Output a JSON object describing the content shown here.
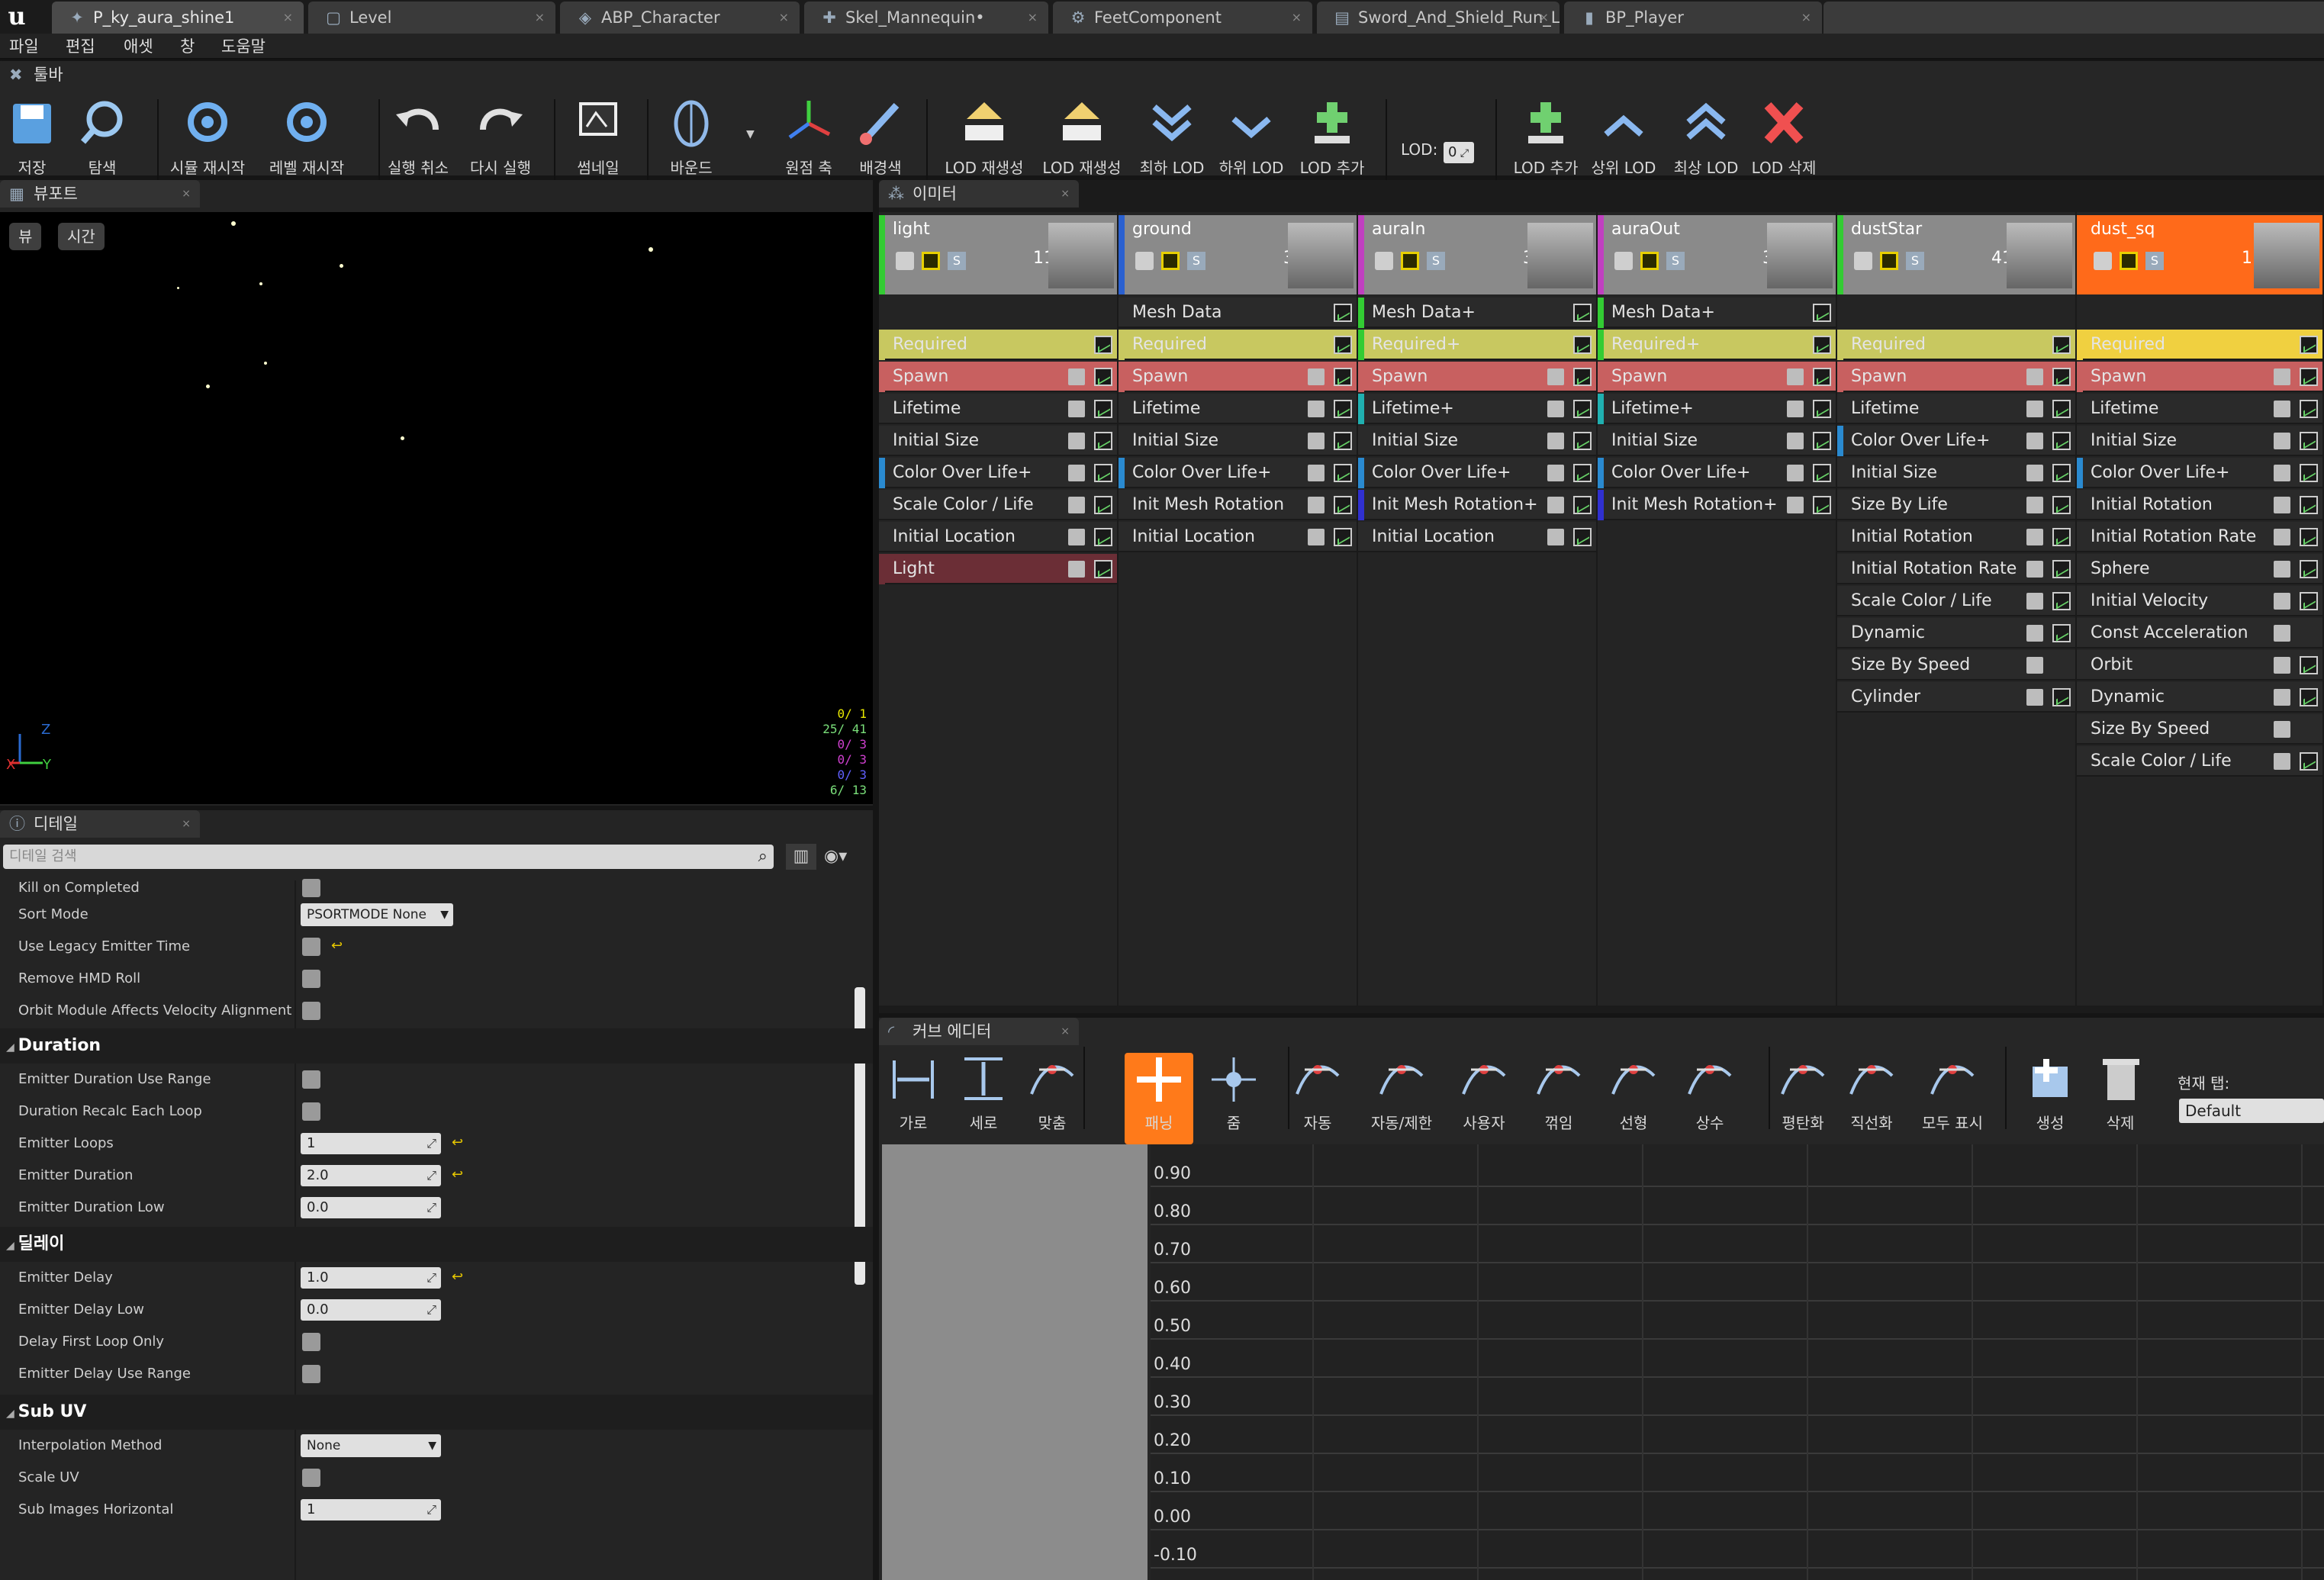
{
  "tabs": [
    {
      "label": "P_ky_aura_shine1",
      "icon": "particle-system-icon",
      "active": true
    },
    {
      "label": "Level",
      "icon": "level-icon",
      "active": false
    },
    {
      "label": "ABP_Character",
      "icon": "anim-blueprint-icon",
      "active": false
    },
    {
      "label": "Skel_Mannequin•",
      "icon": "skeleton-icon",
      "active": false
    },
    {
      "label": "FeetComponent",
      "icon": "component-icon",
      "active": false
    },
    {
      "label": "Sword_And_Shield_Run_L",
      "icon": "anim-sequence-icon",
      "active": false
    },
    {
      "label": "BP_Player",
      "icon": "blueprint-icon",
      "active": false
    }
  ],
  "menu": [
    "파일",
    "편집",
    "애셋",
    "창",
    "도움말"
  ],
  "toolbar_panel": {
    "title": "툴바"
  },
  "toolbar": [
    {
      "label": "저장",
      "icon": "save-icon"
    },
    {
      "label": "탐색",
      "icon": "browse-icon"
    },
    {
      "label": "시뮬 재시작",
      "icon": "restart-sim-icon"
    },
    {
      "label": "레벨 재시작",
      "icon": "restart-level-icon"
    },
    {
      "label": "실행 취소",
      "icon": "undo-icon"
    },
    {
      "label": "다시 실행",
      "icon": "redo-icon"
    },
    {
      "label": "썸네일",
      "icon": "thumbnail-icon"
    },
    {
      "label": "바운드",
      "icon": "bounds-icon"
    },
    {
      "label": "원점 축",
      "icon": "origin-axis-icon"
    },
    {
      "label": "배경색",
      "icon": "background-color-icon"
    },
    {
      "label": "LOD 재생성",
      "icon": "regen-lod-icon"
    },
    {
      "label": "LOD 재생성",
      "icon": "regen-lod-icon"
    },
    {
      "label": "최하 LOD",
      "icon": "lowest-lod-icon"
    },
    {
      "label": "하위 LOD",
      "icon": "lower-lod-icon"
    },
    {
      "label": "LOD 추가",
      "icon": "add-lod-icon"
    },
    {
      "label": "LOD 추가",
      "icon": "add-lod-icon"
    },
    {
      "label": "상위 LOD",
      "icon": "higher-lod-icon"
    },
    {
      "label": "최상 LOD",
      "icon": "highest-lod-icon"
    },
    {
      "label": "LOD 삭제",
      "icon": "delete-lod-icon"
    }
  ],
  "lod": {
    "label": "LOD:",
    "value": "0"
  },
  "viewport": {
    "title": "뷰포트",
    "view_btn": "뷰",
    "time_btn": "시간",
    "stats": [
      {
        "text": "0/  1",
        "color": "#e8e800"
      },
      {
        "text": "25/  41",
        "color": "#7adf7a"
      },
      {
        "text": "0/  3",
        "color": "#d040d0"
      },
      {
        "text": "0/  3",
        "color": "#d040d0"
      },
      {
        "text": "0/  3",
        "color": "#6060ff"
      },
      {
        "text": "6/  13",
        "color": "#7adf7a"
      }
    ],
    "axis": {
      "x": "X",
      "y": "Y",
      "z": "Z"
    }
  },
  "details": {
    "title": "디테일",
    "search_placeholder": "디테일 검색",
    "sections": [
      {
        "name": "",
        "rows": [
          {
            "label": "Kill on Completed",
            "type": "check"
          },
          {
            "label": "Sort Mode",
            "type": "dropdown",
            "value": "PSORTMODE None"
          },
          {
            "label": "Use Legacy Emitter Time",
            "type": "check",
            "reset": true
          },
          {
            "label": "Remove HMD Roll",
            "type": "check"
          },
          {
            "label": "Orbit Module Affects Velocity Alignment",
            "type": "check"
          }
        ]
      },
      {
        "name": "Duration",
        "rows": [
          {
            "label": "Emitter Duration Use Range",
            "type": "check"
          },
          {
            "label": "Duration Recalc Each Loop",
            "type": "check"
          },
          {
            "label": "Emitter Loops",
            "type": "number",
            "value": "1",
            "reset": true
          },
          {
            "label": "Emitter Duration",
            "type": "number",
            "value": "2.0",
            "reset": true
          },
          {
            "label": "Emitter Duration Low",
            "type": "number",
            "value": "0.0"
          }
        ]
      },
      {
        "name": "딜레이",
        "rows": [
          {
            "label": "Emitter Delay",
            "type": "number",
            "value": "1.0",
            "reset": true
          },
          {
            "label": "Emitter Delay Low",
            "type": "number",
            "value": "0.0"
          },
          {
            "label": "Delay First Loop Only",
            "type": "check"
          },
          {
            "label": "Emitter Delay Use Range",
            "type": "check"
          }
        ]
      },
      {
        "name": "Sub UV",
        "rows": [
          {
            "label": "Interpolation Method",
            "type": "dropdown",
            "value": "None"
          },
          {
            "label": "Scale UV",
            "type": "check"
          },
          {
            "label": "Sub Images Horizontal",
            "type": "number",
            "value": "1"
          }
        ]
      }
    ]
  },
  "emitters_panel": {
    "title": "이미터"
  },
  "emitters": [
    {
      "name": "light",
      "count": "11",
      "bar": "#33cc33",
      "head": "#8a8a8a",
      "modules": [
        {
          "label": "Required",
          "color": "#c8c860",
          "bar": "#c8c860",
          "checks": "g"
        },
        {
          "label": "Spawn",
          "color": "#c86060",
          "bar": "#c86060",
          "checks": "cg"
        },
        {
          "label": "Lifetime",
          "color": "",
          "bar": "",
          "checks": "cg"
        },
        {
          "label": "Initial Size",
          "color": "",
          "bar": "",
          "checks": "cg"
        },
        {
          "label": "Color Over Life+",
          "color": "",
          "bar": "#2a8ad0",
          "checks": "cg"
        },
        {
          "label": "Scale Color / Life",
          "color": "",
          "bar": "",
          "checks": "cg"
        },
        {
          "label": "Initial Location",
          "color": "",
          "bar": "",
          "checks": "cg"
        },
        {
          "label": "Light",
          "color": "#6b2e36",
          "bar": "#6b2e36",
          "checks": "cg"
        }
      ]
    },
    {
      "name": "ground",
      "count": "3",
      "bar": "#2a60d0",
      "head": "#8a8a8a",
      "modules": [
        {
          "label": "Mesh Data",
          "color": "",
          "bar": "",
          "checks": "g"
        },
        {
          "label": "Required",
          "color": "#c8c860",
          "bar": "#c8c860",
          "checks": "g"
        },
        {
          "label": "Spawn",
          "color": "#c86060",
          "bar": "#c86060",
          "checks": "cg"
        },
        {
          "label": "Lifetime",
          "color": "",
          "bar": "",
          "checks": "cg"
        },
        {
          "label": "Initial Size",
          "color": "",
          "bar": "",
          "checks": "cg"
        },
        {
          "label": "Color Over Life+",
          "color": "",
          "bar": "#2a8ad0",
          "checks": "cg"
        },
        {
          "label": "Init Mesh Rotation",
          "color": "",
          "bar": "",
          "checks": "cg"
        },
        {
          "label": "Initial Location",
          "color": "",
          "bar": "",
          "checks": "cg"
        }
      ]
    },
    {
      "name": "auraIn",
      "count": "3",
      "bar": "#c040c0",
      "head": "#8a8a8a",
      "modules": [
        {
          "label": "Mesh Data+",
          "color": "",
          "bar": "#33cc33",
          "checks": "g"
        },
        {
          "label": "Required+",
          "color": "#c8c860",
          "bar": "#33cc33",
          "checks": "g"
        },
        {
          "label": "Spawn",
          "color": "#c86060",
          "bar": "#c86060",
          "checks": "cg"
        },
        {
          "label": "Lifetime+",
          "color": "",
          "bar": "#20b0b0",
          "checks": "cg"
        },
        {
          "label": "Initial Size",
          "color": "",
          "bar": "",
          "checks": "cg"
        },
        {
          "label": "Color Over Life+",
          "color": "",
          "bar": "#2a8ad0",
          "checks": "cg"
        },
        {
          "label": "Init Mesh Rotation+",
          "color": "",
          "bar": "#3030d0",
          "checks": "cg"
        },
        {
          "label": "Initial Location",
          "color": "",
          "bar": "",
          "checks": "cg"
        }
      ]
    },
    {
      "name": "auraOut",
      "count": "3",
      "bar": "#c040c0",
      "head": "#8a8a8a",
      "modules": [
        {
          "label": "Mesh Data+",
          "color": "",
          "bar": "#33cc33",
          "checks": "g"
        },
        {
          "label": "Required+",
          "color": "#c8c860",
          "bar": "#33cc33",
          "checks": "g"
        },
        {
          "label": "Spawn",
          "color": "#c86060",
          "bar": "#c86060",
          "checks": "cg"
        },
        {
          "label": "Lifetime+",
          "color": "",
          "bar": "#20b0b0",
          "checks": "cg"
        },
        {
          "label": "Initial Size",
          "color": "",
          "bar": "",
          "checks": "cg"
        },
        {
          "label": "Color Over Life+",
          "color": "",
          "bar": "#2a8ad0",
          "checks": "cg"
        },
        {
          "label": "Init Mesh Rotation+",
          "color": "",
          "bar": "#3030d0",
          "checks": "cg"
        }
      ]
    },
    {
      "name": "dustStar",
      "count": "41",
      "bar": "#33cc33",
      "head": "#8a8a8a",
      "modules": [
        {
          "label": "Required",
          "color": "#c8c860",
          "bar": "#c8c860",
          "checks": "g"
        },
        {
          "label": "Spawn",
          "color": "#c86060",
          "bar": "#c86060",
          "checks": "cg"
        },
        {
          "label": "Lifetime",
          "color": "",
          "bar": "",
          "checks": "cg"
        },
        {
          "label": "Color Over Life+",
          "color": "",
          "bar": "#2a8ad0",
          "checks": "cg"
        },
        {
          "label": "Initial Size",
          "color": "",
          "bar": "",
          "checks": "cg"
        },
        {
          "label": "Size By Life",
          "color": "",
          "bar": "",
          "checks": "cg"
        },
        {
          "label": "Initial Rotation",
          "color": "",
          "bar": "",
          "checks": "cg"
        },
        {
          "label": "Initial Rotation Rate",
          "color": "",
          "bar": "",
          "checks": "cg"
        },
        {
          "label": "Scale Color / Life",
          "color": "",
          "bar": "",
          "checks": "cg"
        },
        {
          "label": "Dynamic",
          "color": "",
          "bar": "",
          "checks": "cg"
        },
        {
          "label": "Size By Speed",
          "color": "",
          "bar": "",
          "checks": "c"
        },
        {
          "label": "Cylinder",
          "color": "",
          "bar": "",
          "checks": "cg"
        }
      ]
    },
    {
      "name": "dust_sq",
      "count": "1",
      "bar": "#ff6a1a",
      "head": "#ff6a1a",
      "modules": [
        {
          "label": "Required",
          "color": "#f0d040",
          "bar": "#f0d040",
          "checks": "g"
        },
        {
          "label": "Spawn",
          "color": "#c86060",
          "bar": "#c86060",
          "checks": "cg"
        },
        {
          "label": "Lifetime",
          "color": "",
          "bar": "",
          "checks": "cg"
        },
        {
          "label": "Initial Size",
          "color": "",
          "bar": "",
          "checks": "cg"
        },
        {
          "label": "Color Over Life+",
          "color": "",
          "bar": "#2a8ad0",
          "checks": "cg"
        },
        {
          "label": "Initial Rotation",
          "color": "",
          "bar": "",
          "checks": "cg"
        },
        {
          "label": "Initial Rotation Rate",
          "color": "",
          "bar": "",
          "checks": "cg"
        },
        {
          "label": "Sphere",
          "color": "",
          "bar": "",
          "checks": "cg"
        },
        {
          "label": "Initial Velocity",
          "color": "",
          "bar": "",
          "checks": "cg"
        },
        {
          "label": "Const Acceleration",
          "color": "",
          "bar": "",
          "checks": "c"
        },
        {
          "label": "Orbit",
          "color": "",
          "bar": "",
          "checks": "cg"
        },
        {
          "label": "Dynamic",
          "color": "",
          "bar": "",
          "checks": "cg"
        },
        {
          "label": "Size By Speed",
          "color": "",
          "bar": "",
          "checks": "c"
        },
        {
          "label": "Scale Color / Life",
          "color": "",
          "bar": "",
          "checks": "cg"
        }
      ]
    }
  ],
  "curve_editor": {
    "title": "커브 에디터",
    "buttons": [
      {
        "label": "가로",
        "icon": "fit-horizontal-icon"
      },
      {
        "label": "세로",
        "icon": "fit-vertical-icon"
      },
      {
        "label": "맞춤",
        "icon": "fit-icon"
      },
      {
        "label": "패닝",
        "icon": "pan-icon",
        "active": true
      },
      {
        "label": "줌",
        "icon": "zoom-icon"
      },
      {
        "label": "자동",
        "icon": "auto-tangent-icon"
      },
      {
        "label": "자동/제한",
        "icon": "auto-clamped-icon"
      },
      {
        "label": "사용자",
        "icon": "user-tangent-icon"
      },
      {
        "label": "꺾임",
        "icon": "break-tangent-icon"
      },
      {
        "label": "선형",
        "icon": "linear-icon"
      },
      {
        "label": "상수",
        "icon": "constant-icon"
      },
      {
        "label": "평탄화",
        "icon": "flatten-icon"
      },
      {
        "label": "직선화",
        "icon": "straighten-icon"
      },
      {
        "label": "모두 표시",
        "icon": "show-all-icon"
      },
      {
        "label": "생성",
        "icon": "create-tab-icon"
      },
      {
        "label": "삭제",
        "icon": "delete-tab-icon"
      }
    ],
    "current_tab_label": "현재 탭:",
    "current_tab_value": "Default",
    "y_labels": [
      "0.90",
      "0.80",
      "0.70",
      "0.60",
      "0.50",
      "0.40",
      "0.30",
      "0.20",
      "0.10",
      "0.00",
      "-0.10"
    ]
  }
}
